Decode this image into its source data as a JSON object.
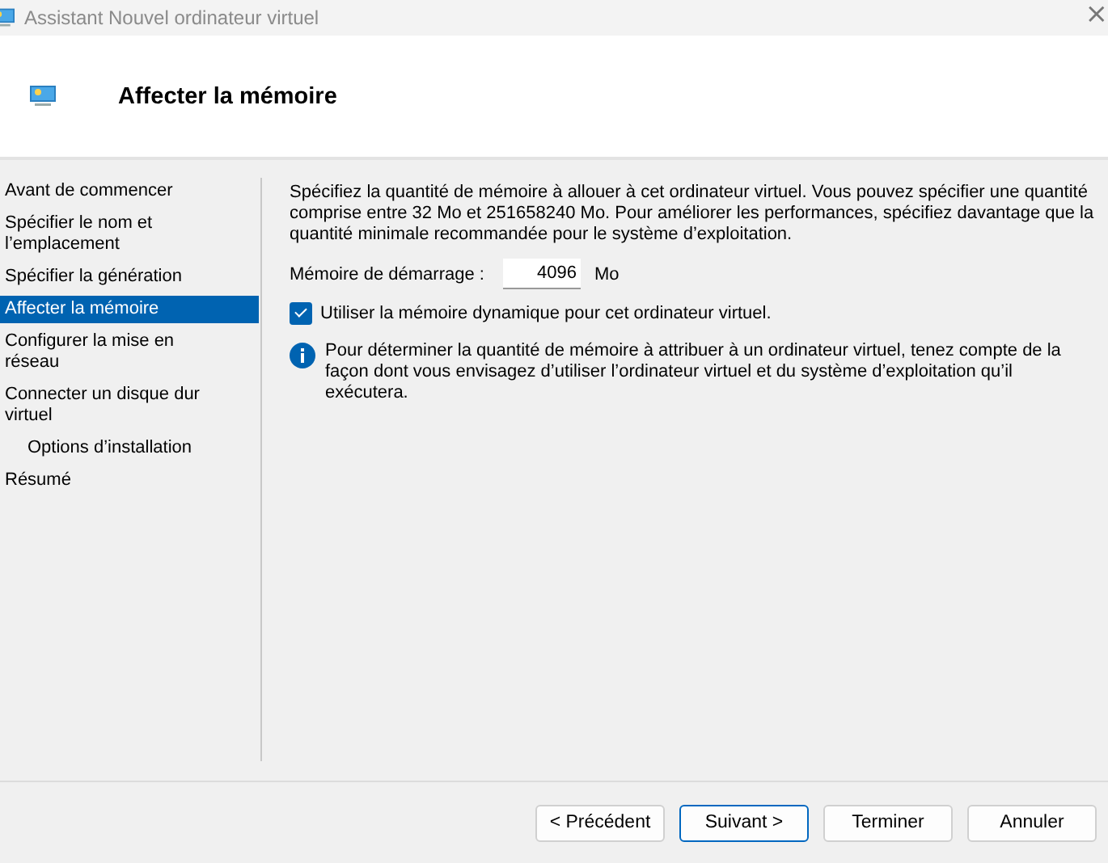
{
  "window": {
    "title": "Assistant Nouvel ordinateur virtuel",
    "close": "×"
  },
  "header": {
    "title": "Affecter la mémoire"
  },
  "steps": [
    {
      "label": "Avant de commencer",
      "selected": false
    },
    {
      "label": "Spécifier le nom et l’emplacement",
      "selected": false
    },
    {
      "label": "Spécifier la génération",
      "selected": false
    },
    {
      "label": "Affecter la mémoire",
      "selected": true
    },
    {
      "label": "Configurer la mise en réseau",
      "selected": false
    },
    {
      "label": "Connecter un disque dur virtuel",
      "selected": false,
      "children": [
        {
          "label": "Options d’installation",
          "selected": false
        }
      ]
    },
    {
      "label": "Résumé",
      "selected": false
    }
  ],
  "intro": "Spécifiez la quantité de mémoire à allouer à cet ordinateur virtuel. Vous pouvez spécifier une quantité comprise entre 32 Mo et 251658240 Mo. Pour améliorer les performances, spécifiez davantage que la quantité minimale recommandée pour le système d’exploitation.",
  "startup_memory": {
    "label": "Mémoire de démarrage :",
    "value": "4096",
    "unit": "Mo"
  },
  "dynamic_memory": {
    "label": "Utiliser la mémoire dynamique pour cet ordinateur virtuel.",
    "checked": true
  },
  "info": "Pour déterminer la quantité de mémoire à attribuer à un ordinateur virtuel, tenez compte de la façon dont vous envisagez d’utiliser l’ordinateur virtuel et du système d’exploitation qu’il exécutera.",
  "buttons": [
    {
      "label": "< Précédent",
      "default": false
    },
    {
      "label": "Suivant >",
      "default": true
    },
    {
      "label": "Terminer",
      "default": false
    },
    {
      "label": "Annuler",
      "default": false
    }
  ]
}
